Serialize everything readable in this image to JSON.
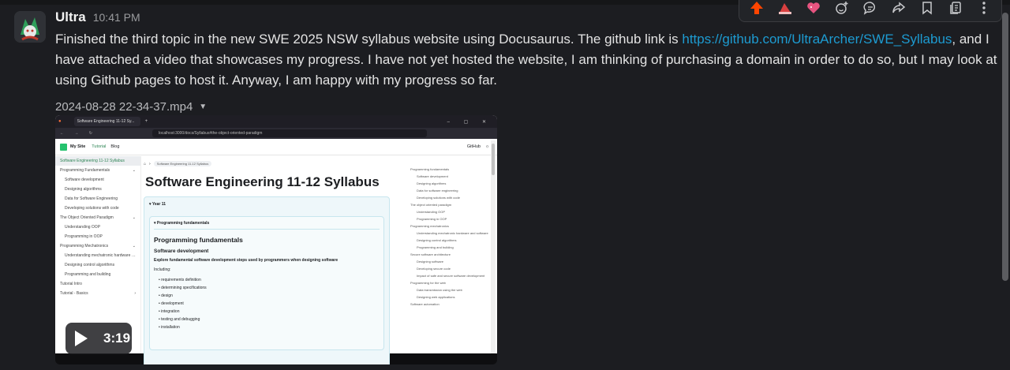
{
  "message": {
    "author": "Ultra",
    "time": "10:41 PM",
    "text_before_link": "Finished the third topic in the new SWE 2025 NSW syllabus website using Docusaurus. The github link is ",
    "link": "https://github.com/UltraArcher/SWE_Syllabus",
    "text_after_link": ", and I have attached a video that showcases my progress. I have not yet hosted the website, I am thinking of purchasing a domain in order to do so, but I may look at using Github pages to host it. Anyway, I am happy with my progress so far.",
    "attachment_name": "2024-08-28 22-34-37.mp4"
  },
  "toolbar_icons": [
    "upvote-icon",
    "hat-icon",
    "heart-icon",
    "add-reaction-icon",
    "reply-icon",
    "share-icon",
    "bookmark-icon",
    "copy-icon",
    "more-icon"
  ],
  "video": {
    "duration": "3:19",
    "browser_tab": "Software Engineering 11-12 Sy...",
    "url": "localhost:3000/docs/Syllabus#the-object-oriented-paradigm",
    "site_title": "My Site",
    "nav_tutorial": "Tutorial",
    "nav_blog": "Blog",
    "nav_github": "GitHub",
    "crumb": "Software Engineering 11-12 Syllabus",
    "page_title": "Software Engineering 11-12 Syllabus",
    "year": "Year 11",
    "details_label": "Programming fundamentals",
    "h2": "Programming fundamentals",
    "h3": "Software development",
    "lead": "Explore fundamental software development steps used by programmers when designing software",
    "including": "Including:",
    "bullets": [
      "requirements definition",
      "determining specifications",
      "design",
      "development",
      "integration",
      "testing and debugging",
      "installation"
    ],
    "sidebar": [
      {
        "label": "Software Engineering 11-12 Syllabus",
        "sub": false,
        "active": true,
        "arrow": ""
      },
      {
        "label": "Programming Fundamentals",
        "sub": false,
        "active": false,
        "arrow": "⌄"
      },
      {
        "label": "Software development",
        "sub": true,
        "active": false,
        "arrow": ""
      },
      {
        "label": "Designing algorithms",
        "sub": true,
        "active": false,
        "arrow": ""
      },
      {
        "label": "Data for Software Engineering",
        "sub": true,
        "active": false,
        "arrow": ""
      },
      {
        "label": "Developing solutions with code",
        "sub": true,
        "active": false,
        "arrow": ""
      },
      {
        "label": "The Object Oriented Paradigm",
        "sub": false,
        "active": false,
        "arrow": "⌄"
      },
      {
        "label": "Understanding OOP",
        "sub": true,
        "active": false,
        "arrow": ""
      },
      {
        "label": "Programming in OOP",
        "sub": true,
        "active": false,
        "arrow": ""
      },
      {
        "label": "Programming Mechatronics",
        "sub": false,
        "active": false,
        "arrow": "⌄"
      },
      {
        "label": "Understanding mechatronic hardware and software",
        "sub": true,
        "active": false,
        "arrow": ""
      },
      {
        "label": "Designing control algorithms",
        "sub": true,
        "active": false,
        "arrow": ""
      },
      {
        "label": "Programming and building",
        "sub": true,
        "active": false,
        "arrow": ""
      },
      {
        "label": "Tutorial Intro",
        "sub": false,
        "active": false,
        "arrow": ""
      },
      {
        "label": "Tutorial - Basics",
        "sub": false,
        "active": false,
        "arrow": "›"
      }
    ],
    "toc": [
      {
        "label": "Programming fundamentals",
        "s": false
      },
      {
        "label": "Software development",
        "s": true
      },
      {
        "label": "Designing algorithms",
        "s": true
      },
      {
        "label": "Data for software engineering",
        "s": true
      },
      {
        "label": "Developing solutions with code",
        "s": true
      },
      {
        "label": "The object oriented paradigm",
        "s": false
      },
      {
        "label": "Understanding OOP",
        "s": true
      },
      {
        "label": "Programming in OOP",
        "s": true
      },
      {
        "label": "Programming mechatronics",
        "s": false
      },
      {
        "label": "Understanding mechatronic hardware and software",
        "s": true
      },
      {
        "label": "Designing control algorithms",
        "s": true
      },
      {
        "label": "Programming and building",
        "s": true
      },
      {
        "label": "Secure software architecture",
        "s": false
      },
      {
        "label": "Designing software",
        "s": true
      },
      {
        "label": "Developing secure code",
        "s": true
      },
      {
        "label": "Impact of safe and secure software development",
        "s": true
      },
      {
        "label": "Programming for the web",
        "s": false
      },
      {
        "label": "Data transmission using the web",
        "s": true
      },
      {
        "label": "Designing web applications",
        "s": true
      },
      {
        "label": "Software automation",
        "s": false
      }
    ]
  }
}
